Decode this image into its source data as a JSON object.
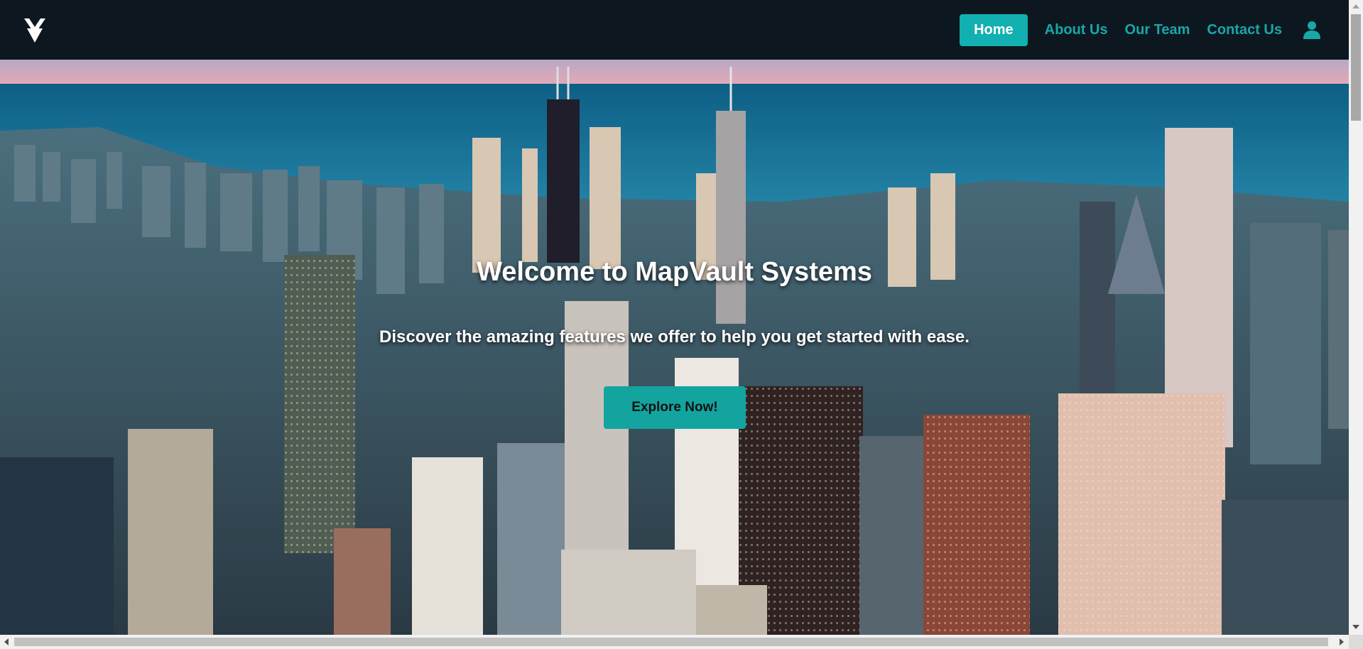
{
  "header": {
    "logo_icon": "mapvault-logo-icon",
    "nav": {
      "home": "Home",
      "about": "About Us",
      "team": "Our Team",
      "contact": "Contact Us"
    },
    "user_icon": "user-profile-icon"
  },
  "hero": {
    "title": "Welcome to MapVault Systems",
    "subtitle": "Discover the amazing features we offer to help you get started with ease.",
    "cta_label": "Explore Now!"
  },
  "colors": {
    "navbar_bg": "#0d1720",
    "accent": "#12b0b0",
    "link": "#17a8a8"
  }
}
